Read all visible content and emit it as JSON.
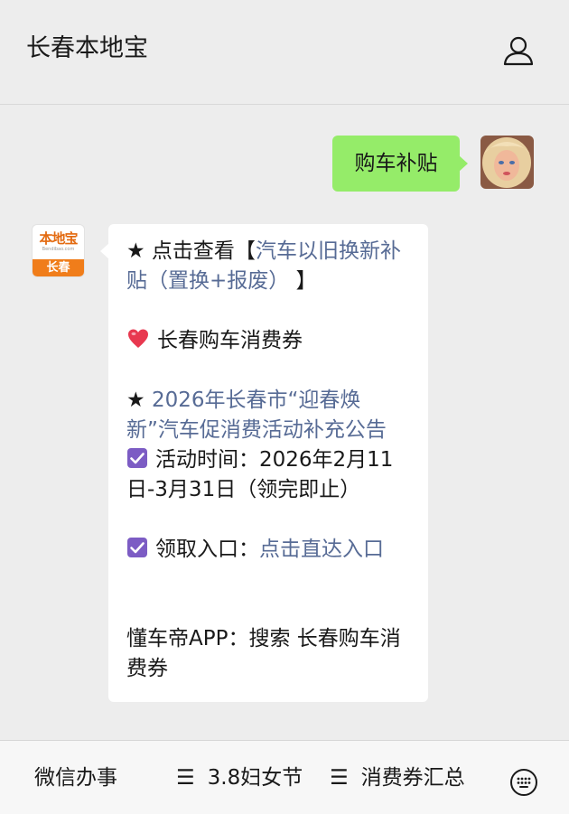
{
  "header": {
    "title": "长春本地宝",
    "profile_icon": "person-icon"
  },
  "conversation": {
    "user_message": "购车补贴",
    "bot_avatar": {
      "brand": "本地宝",
      "domain": "Bendibao.com",
      "city": "长春"
    },
    "reply": {
      "line1_star": "★",
      "line1_prefix": " 点击查看【",
      "line1_link": "汽车以旧换新补贴（置换+报废）",
      "line1_suffix": " 】",
      "heart_icon": "heart-icon",
      "heart_text": "长春购车消费券",
      "line3_star": "★",
      "line3_link": "2026年长春市“迎春焕新”汽车促消费活动补充公告",
      "checkbox_icon": "checkbox-icon",
      "activity_time": "活动时间：2026年2月11日-3月31日（领完即止）",
      "entry_label": "领取入口：",
      "entry_link": "点击直达入口",
      "app_text": "懂车帝APP：搜索 长春购车消费券"
    }
  },
  "bottom_menu": {
    "items": [
      {
        "label": "微信办事"
      },
      {
        "label": "3.8妇女节"
      },
      {
        "label": "消费券汇总"
      }
    ],
    "keyboard_icon": "keyboard-icon"
  },
  "colors": {
    "background": "#ededed",
    "user_bubble": "#95ec69",
    "link": "#576b95",
    "checkbox": "#7c5cc4",
    "heart": "#e8384f",
    "brand_orange": "#f07d1a"
  }
}
